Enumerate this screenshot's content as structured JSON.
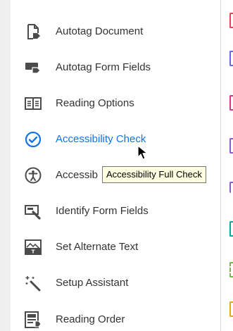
{
  "menu": {
    "items": [
      {
        "label": "Autotag Document",
        "icon": "document-tag-icon"
      },
      {
        "label": "Autotag Form Fields",
        "icon": "form-field-tag-icon"
      },
      {
        "label": "Reading Options",
        "icon": "reading-options-icon"
      },
      {
        "label": "Accessibility Check",
        "icon": "check-circle-icon",
        "active": true
      },
      {
        "label": "Accessib",
        "icon": "accessibility-person-icon"
      },
      {
        "label": "Identify Form Fields",
        "icon": "identify-form-fields-icon"
      },
      {
        "label": "Set Alternate Text",
        "icon": "alternate-text-icon"
      },
      {
        "label": "Setup Assistant",
        "icon": "setup-assistant-wand-icon"
      },
      {
        "label": "Reading Order",
        "icon": "reading-order-icon"
      }
    ]
  },
  "tooltip": {
    "text": "Accessibility Full Check"
  },
  "colors": {
    "accent": "#1473e6",
    "text": "#333333",
    "icon": "#4b4b4b",
    "tooltip_bg": "#ffffe1",
    "strip": [
      "#e34850",
      "#6767ec",
      "#d83790",
      "#9256d9",
      "#9256d9",
      "#12a4a0",
      "#70b94a",
      "#e8a716"
    ]
  }
}
